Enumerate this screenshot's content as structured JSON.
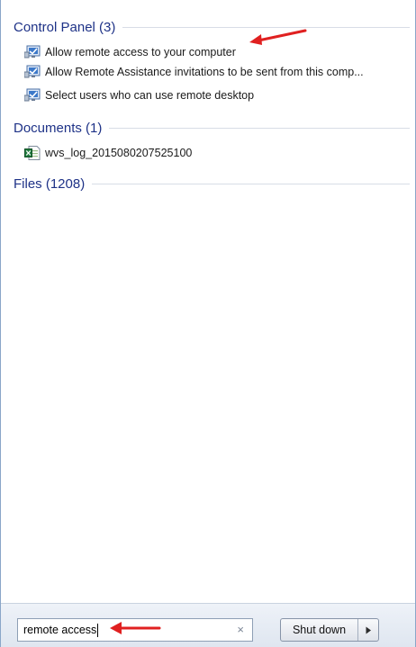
{
  "results": {
    "groups": [
      {
        "title": "Control Panel (3)",
        "items": [
          {
            "label": "Allow remote access to your computer",
            "icon": "control-panel-icon"
          },
          {
            "label": "Allow Remote Assistance invitations to be sent from this comp...",
            "icon": "control-panel-icon"
          },
          {
            "label": "Select users who can use remote desktop",
            "icon": "control-panel-icon"
          }
        ]
      },
      {
        "title": "Documents (1)",
        "items": [
          {
            "label": "wvs_log_2015080207525100",
            "icon": "excel-file-icon"
          }
        ]
      },
      {
        "title": "Files (1208)",
        "items": []
      }
    ]
  },
  "search": {
    "value": "remote access",
    "clear_icon": "×"
  },
  "shutdown": {
    "label": "Shut down",
    "arrow_icon": "triangle-right-icon"
  },
  "annotation": {
    "arrow_color": "#e02020"
  }
}
